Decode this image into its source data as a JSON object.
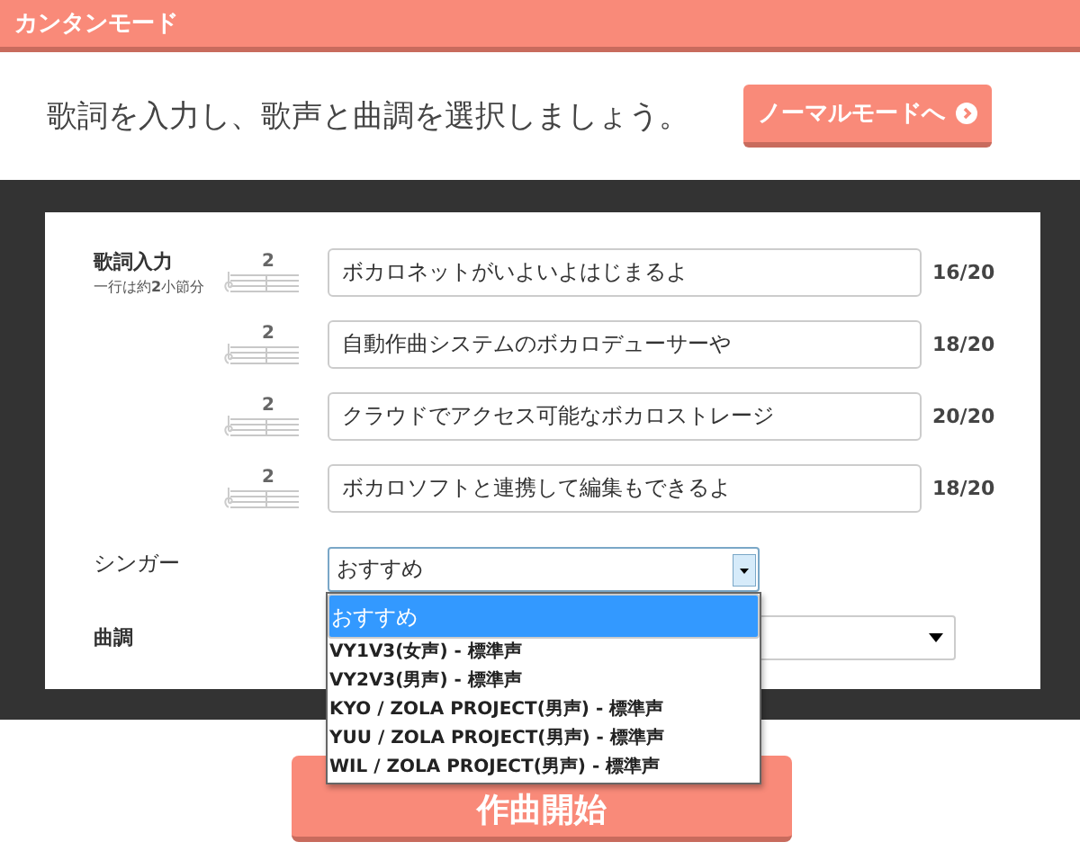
{
  "header": {
    "title": "カンタンモード"
  },
  "intro": {
    "text": "歌詞を入力し、歌声と曲調を選択しましょう。",
    "button": "ノーマルモードへ"
  },
  "lyrics": {
    "label": "歌詞入力",
    "hint": "一行は約**2**小節分",
    "rows": [
      {
        "measure": "2",
        "value": "ボカロネットがいよいよはじまるよ",
        "count": "16/20"
      },
      {
        "measure": "2",
        "value": "自動作曲システムのボカロデューサーや",
        "count": "18/20"
      },
      {
        "measure": "2",
        "value": "クラウドでアクセス可能なボカロストレージ",
        "count": "20/20"
      },
      {
        "measure": "2",
        "value": "ボカロソフトと連携して編集もできるよ",
        "count": "18/20"
      }
    ]
  },
  "singer": {
    "label": "シンガー",
    "value": "おすすめ",
    "expanded": true,
    "options": [
      {
        "label": "おすすめ",
        "selected": true
      },
      {
        "label": "VY1V3(女声) - 標準声",
        "selected": false
      },
      {
        "label": "VY2V3(男声) - 標準声",
        "selected": false
      },
      {
        "label": "KYO / ZOLA PROJECT(男声) - 標準声",
        "selected": false
      },
      {
        "label": "YUU / ZOLA PROJECT(男声) - 標準声",
        "selected": false
      },
      {
        "label": "WIL / ZOLA PROJECT(男声) - 標準声",
        "selected": false
      }
    ]
  },
  "mood": {
    "label": "曲調"
  },
  "start_button": "作曲開始"
}
